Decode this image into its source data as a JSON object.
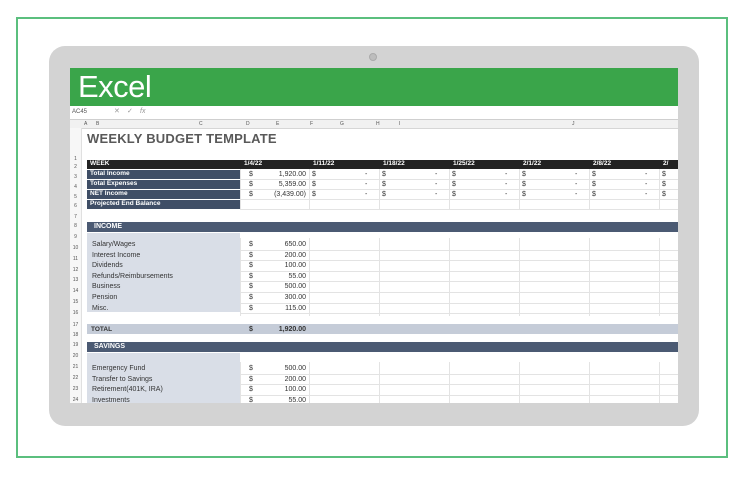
{
  "app": {
    "name": "Excel",
    "name_box": "AC45",
    "fx": "fx"
  },
  "columns": [
    "A",
    "B",
    "C",
    "D",
    "E",
    "F",
    "G",
    "H",
    "I",
    "J"
  ],
  "sheet": {
    "title": "WEEKLY BUDGET TEMPLATE",
    "week_label": "WEEK",
    "weeks": [
      "1/4/22",
      "1/11/22",
      "1/18/22",
      "1/25/22",
      "2/1/22",
      "2/8/22",
      "2/"
    ],
    "summary": [
      {
        "label": "Total Income",
        "cur": "$",
        "value": "1,920.00"
      },
      {
        "label": "Total Expenses",
        "cur": "$",
        "value": "5,359.00"
      },
      {
        "label": "NET Income",
        "cur": "$",
        "value": "(3,439.00)"
      },
      {
        "label": "Projected End Balance",
        "cur": "",
        "value": ""
      }
    ],
    "dash_cur": "$",
    "dash": "-",
    "income": {
      "header": "INCOME",
      "items": [
        {
          "label": "Salary/Wages",
          "cur": "$",
          "value": "650.00"
        },
        {
          "label": "Interest Income",
          "cur": "$",
          "value": "200.00"
        },
        {
          "label": "Dividends",
          "cur": "$",
          "value": "100.00"
        },
        {
          "label": "Refunds/Reimbursements",
          "cur": "$",
          "value": "55.00"
        },
        {
          "label": "Business",
          "cur": "$",
          "value": "500.00"
        },
        {
          "label": "Pension",
          "cur": "$",
          "value": "300.00"
        },
        {
          "label": "Misc.",
          "cur": "$",
          "value": "115.00"
        }
      ],
      "total_label": "TOTAL",
      "total_cur": "$",
      "total_value": "1,920.00"
    },
    "savings": {
      "header": "SAVINGS",
      "items": [
        {
          "label": "Emergency Fund",
          "cur": "$",
          "value": "500.00"
        },
        {
          "label": "Transfer to Savings",
          "cur": "$",
          "value": "200.00"
        },
        {
          "label": "Retirement(401K, IRA)",
          "cur": "$",
          "value": "100.00"
        },
        {
          "label": "Investments",
          "cur": "$",
          "value": "55.00"
        }
      ]
    }
  },
  "row_numbers": [
    "1",
    "2",
    "3",
    "4",
    "5",
    "6",
    "7",
    "8",
    "9",
    "10",
    "11",
    "12",
    "13",
    "14",
    "15",
    "16",
    "17",
    "18",
    "19",
    "20",
    "21",
    "22",
    "23",
    "24",
    "25"
  ],
  "colors": {
    "brand": "#3aa54a",
    "navy": "#3f4e66",
    "frame": "#5bbf7e"
  }
}
